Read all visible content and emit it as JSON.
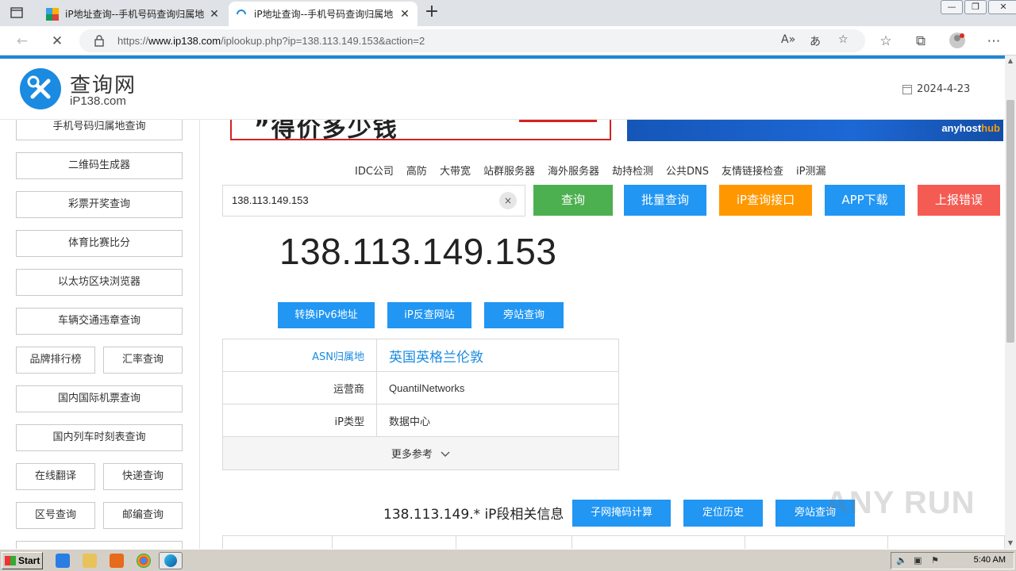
{
  "browser": {
    "tabs": [
      {
        "title": "iP地址查询--手机号码查询归属地",
        "active": false
      },
      {
        "title": "iP地址查询--手机号码查询归属地",
        "active": true
      }
    ],
    "url_prefix": "https://",
    "url_domain": "www.ip138.com",
    "url_path": "/iplookup.php?ip=138.113.149.153&action=2"
  },
  "header": {
    "logo_cn": "查询网",
    "logo_en": "iP138.com",
    "date": "2024-4-23"
  },
  "sidebar": {
    "items": [
      {
        "label": "手机号码归属地查询"
      },
      {
        "label": "二维码生成器"
      },
      {
        "label": "彩票开奖查询"
      },
      {
        "label": "体育比赛比分"
      },
      {
        "label": "以太坊区块浏览器"
      },
      {
        "label": "车辆交通违章查询"
      },
      {
        "label": "品牌排行榜"
      },
      {
        "label": "汇率查询"
      },
      {
        "label": "国内国际机票查询"
      },
      {
        "label": "国内列车时刻表查询"
      },
      {
        "label": "在线翻译"
      },
      {
        "label": "快递查询"
      },
      {
        "label": "区号查询"
      },
      {
        "label": "邮编查询"
      }
    ]
  },
  "banners": {
    "left_text": "”得价多少钱",
    "right_brand_a": "anyhost",
    "right_brand_b": "hub"
  },
  "nav_links": [
    "IDC公司",
    "高防",
    "大带宽",
    "站群服务器",
    "海外服务器",
    "劫持检测",
    "公共DNS",
    "友情链接检查",
    "iP测漏"
  ],
  "search": {
    "value": "138.113.149.153",
    "clear_symbol": "×"
  },
  "actions": [
    {
      "label": "查询",
      "color": "#4caf50"
    },
    {
      "label": "批量查询",
      "color": "#2196f3"
    },
    {
      "label": "iP查询接口",
      "color": "#ff9800"
    },
    {
      "label": "APP下载",
      "color": "#2196f3"
    },
    {
      "label": "上报错误",
      "color": "#f45b53"
    }
  ],
  "result": {
    "ip": "138.113.149.153",
    "buttons": [
      "转换iPv6地址",
      "iP反查网站",
      "旁站查询"
    ],
    "rows": [
      {
        "key": "ASN归属地",
        "value": "英国英格兰伦敦"
      },
      {
        "key": "运营商",
        "value": "QuantilNetworks"
      },
      {
        "key": "iP类型",
        "value": "数据中心"
      }
    ],
    "more": "更多参考"
  },
  "segment": {
    "title": "138.113.149.* iP段相关信息",
    "buttons": [
      "子网掩码计算",
      "定位历史",
      "旁站查询"
    ]
  },
  "watermark": "ANY RUN",
  "taskbar": {
    "start": "Start",
    "time": "5:40 AM"
  }
}
